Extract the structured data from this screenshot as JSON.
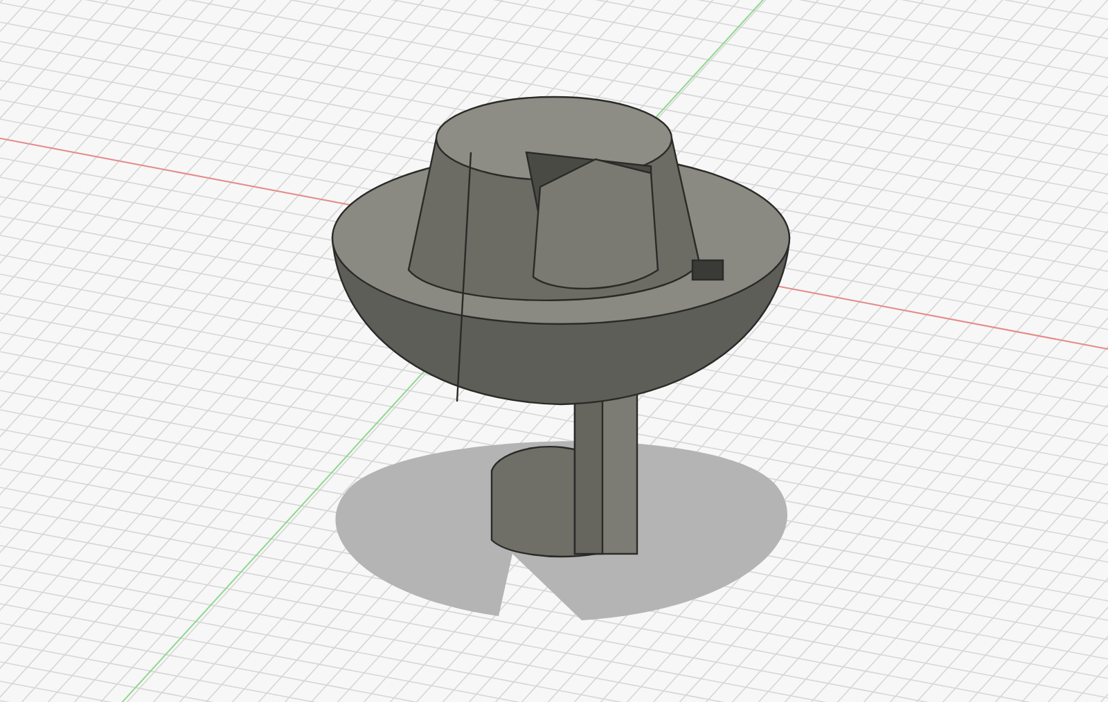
{
  "axes": [
    {
      "color": "#e88a8a"
    },
    {
      "color": "#8fd88f"
    }
  ]
}
